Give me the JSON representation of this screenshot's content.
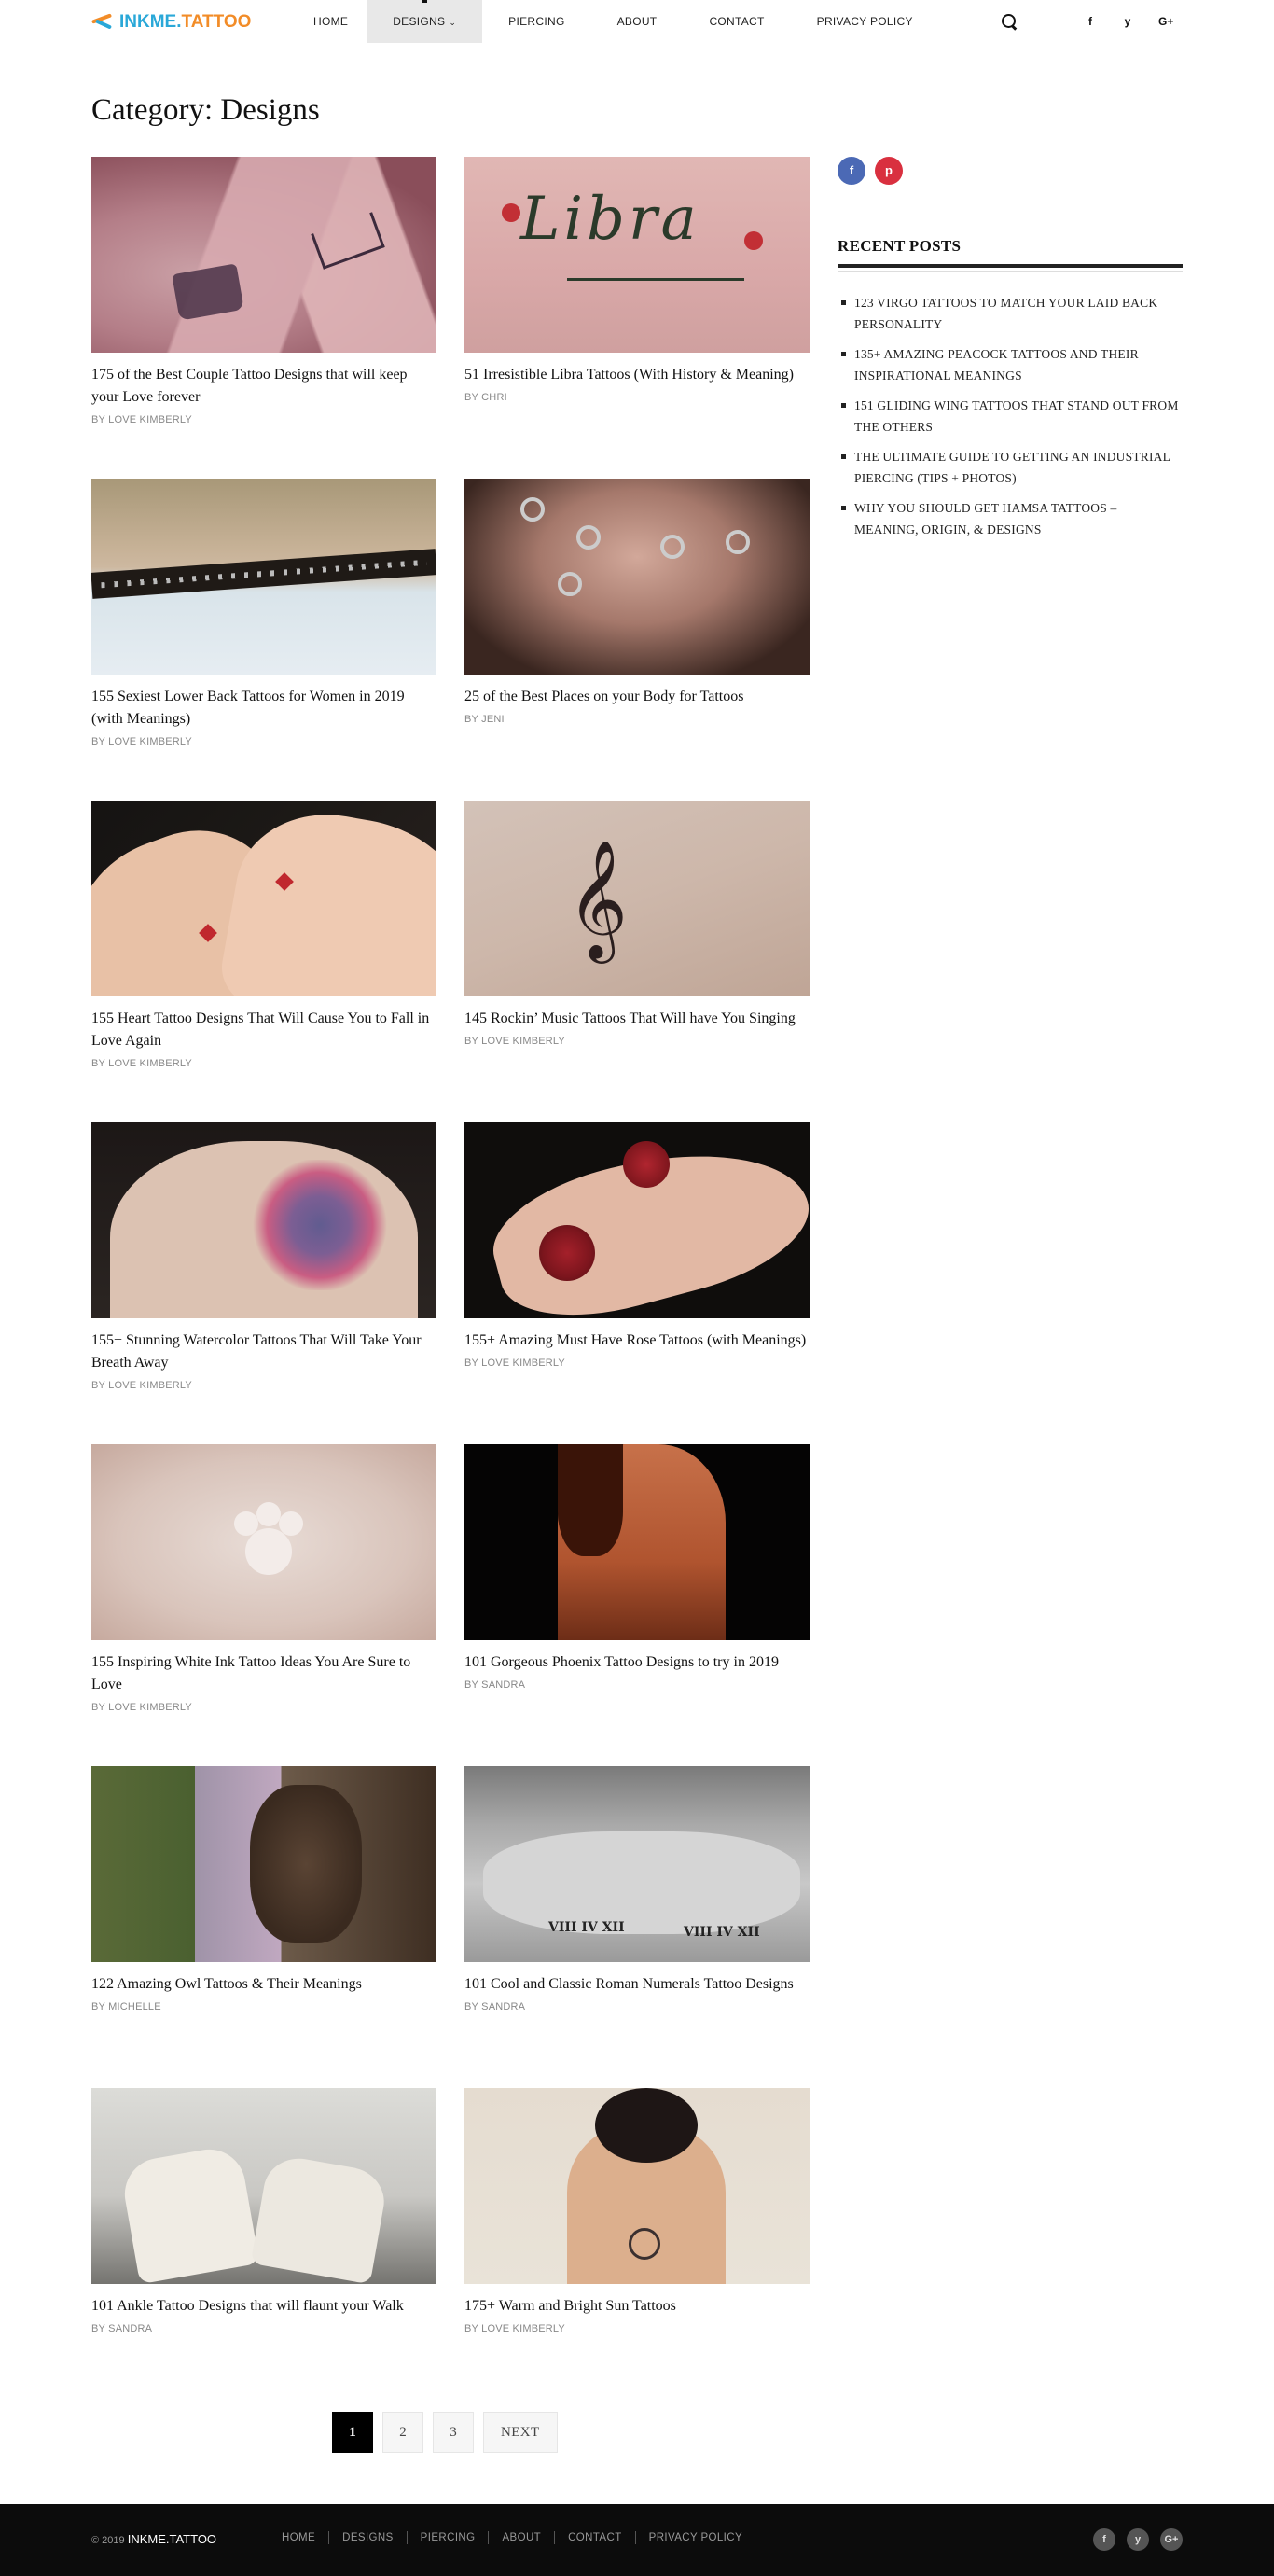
{
  "site": {
    "logo_part1": "INKME.",
    "logo_part2": "TATTOO"
  },
  "nav": {
    "items": [
      {
        "label": "HOME"
      },
      {
        "label": "DESIGNS"
      },
      {
        "label": "PIERCING"
      },
      {
        "label": "ABOUT"
      },
      {
        "label": "CONTACT"
      },
      {
        "label": "PRIVACY POLICY"
      }
    ],
    "active": "DESIGNS",
    "social": [
      "f",
      "y",
      "G+"
    ]
  },
  "page_title": "Category: Designs",
  "posts": [
    {
      "title": "175 of the Best Couple Tattoo Designs that will keep your Love forever",
      "by": "BY",
      "author": "LOVE KIMBERLY"
    },
    {
      "title": "51 Irresistible Libra Tattoos (With History & Meaning)",
      "by": "BY",
      "author": "CHRI"
    },
    {
      "title": "155 Sexiest Lower Back Tattoos for Women in 2019 (with Meanings)",
      "by": "BY",
      "author": "LOVE KIMBERLY"
    },
    {
      "title": "25 of the Best Places on your Body for Tattoos",
      "by": "BY",
      "author": "JENI"
    },
    {
      "title": "155 Heart Tattoo Designs That Will Cause You to Fall in Love Again",
      "by": "BY",
      "author": "LOVE KIMBERLY"
    },
    {
      "title": "145 Rockin’ Music Tattoos That Will have You Singing",
      "by": "BY",
      "author": "LOVE KIMBERLY"
    },
    {
      "title": "155+ Stunning Watercolor Tattoos That Will Take Your Breath Away",
      "by": "BY",
      "author": "LOVE KIMBERLY"
    },
    {
      "title": "155+ Amazing Must Have Rose Tattoos (with Meanings)",
      "by": "BY",
      "author": "LOVE KIMBERLY"
    },
    {
      "title": "155 Inspiring White Ink Tattoo Ideas You Are Sure to Love",
      "by": "BY",
      "author": "LOVE KIMBERLY"
    },
    {
      "title": "101 Gorgeous Phoenix Tattoo Designs to try in 2019",
      "by": "BY",
      "author": "SANDRA"
    },
    {
      "title": "122 Amazing Owl Tattoos & Their Meanings",
      "by": "BY",
      "author": "MICHELLE"
    },
    {
      "title": "101 Cool and Classic Roman Numerals Tattoo Designs",
      "by": "BY",
      "author": "SANDRA"
    },
    {
      "title": "101 Ankle Tattoo Designs that will flaunt your Walk",
      "by": "BY",
      "author": "SANDRA"
    },
    {
      "title": "175+ Warm and Bright Sun Tattoos",
      "by": "BY",
      "author": "LOVE KIMBERLY"
    }
  ],
  "thumb_text": {
    "libra": "Libra",
    "clef": "𝄞",
    "numerals_left": "VIII IV XII",
    "numerals_right": "VIII IV XII"
  },
  "pagination": {
    "pages": [
      "1",
      "2",
      "3"
    ],
    "current": "1",
    "next": "NEXT"
  },
  "sidebar": {
    "share": [
      "f",
      "p"
    ],
    "recent_title": "RECENT POSTS",
    "recent_posts": [
      "123 VIRGO TATTOOS TO MATCH YOUR LAID BACK PERSONALITY",
      "135+ AMAZING PEACOCK TATTOOS AND THEIR INSPIRATIONAL MEANINGS",
      "151 GLIDING WING TATTOOS THAT STAND OUT FROM THE OTHERS",
      "THE ULTIMATE GUIDE TO GETTING AN INDUSTRIAL PIERCING (TIPS + PHOTOS)",
      "WHY YOU SHOULD GET HAMSA TATTOOS – MEANING, ORIGIN, & DESIGNS"
    ]
  },
  "footer": {
    "copyright": "© 2019",
    "brand": "INKME.TATTOO",
    "nav": [
      "HOME",
      "DESIGNS",
      "PIERCING",
      "ABOUT",
      "CONTACT",
      "PRIVACY POLICY"
    ],
    "social": [
      "f",
      "y",
      "G+"
    ]
  },
  "colors": {
    "logo_blue": "#2aa8d8",
    "logo_orange": "#f28c28",
    "facebook": "#4b69b5",
    "pinterest": "#d9303f",
    "footer_bg": "#0c0c0c"
  }
}
